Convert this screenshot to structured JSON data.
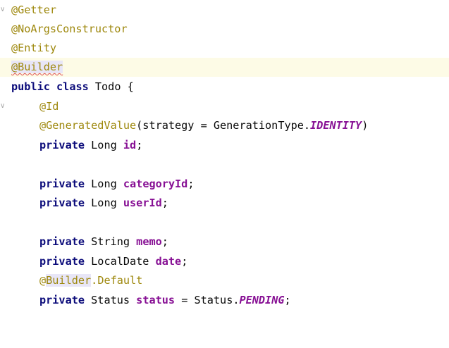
{
  "editor": {
    "lines": [
      {
        "tokens": [
          "@Getter"
        ]
      },
      {
        "tokens": [
          "@NoArgsConstructor"
        ]
      },
      {
        "tokens": [
          "@Entity"
        ]
      },
      {
        "tokens": [
          "@Builder"
        ]
      },
      {
        "tokens": [
          "public",
          " ",
          "class",
          " Todo {"
        ]
      },
      {
        "tokens": [
          "@Id"
        ]
      },
      {
        "tokens": [
          "@GeneratedValue",
          "(strategy = GenerationType.",
          "IDENTITY",
          ")"
        ]
      },
      {
        "tokens": [
          "private",
          " Long ",
          "id",
          ";"
        ]
      },
      {
        "tokens": []
      },
      {
        "tokens": [
          "private",
          " Long ",
          "categoryId",
          ";"
        ]
      },
      {
        "tokens": [
          "private",
          " Long ",
          "userId",
          ";"
        ]
      },
      {
        "tokens": []
      },
      {
        "tokens": [
          "private",
          " String ",
          "memo",
          ";"
        ]
      },
      {
        "tokens": [
          "private",
          " LocalDate ",
          "date",
          ";"
        ]
      },
      {
        "tokens": [
          "@",
          "Builder",
          ".Default"
        ]
      },
      {
        "tokens": [
          "private",
          " Status ",
          "status",
          " = Status.",
          "PENDING",
          ";"
        ]
      }
    ],
    "current_line": 4,
    "fold_markers": [
      1,
      6
    ],
    "colors": {
      "annotation": "#9e880d",
      "keyword": "#0b0b7a",
      "field": "#871094",
      "current_line_bg": "#fdfbe6",
      "error_underline": "#e05555"
    }
  }
}
